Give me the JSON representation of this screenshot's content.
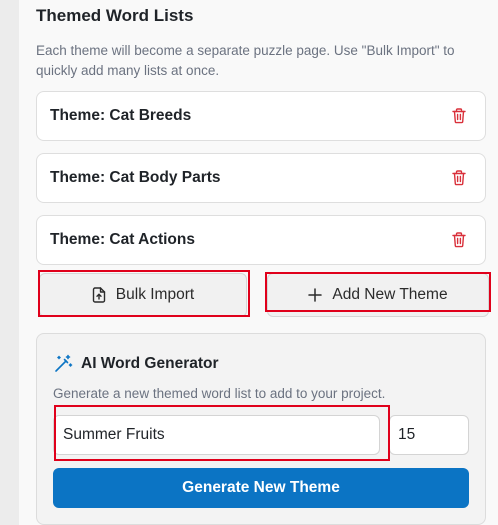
{
  "section": {
    "title": "Themed Word Lists",
    "description": "Each theme will become a separate puzzle page. Use \"Bulk Import\" to quickly add many lists at once."
  },
  "themes": [
    {
      "label": "Theme: Cat Breeds"
    },
    {
      "label": "Theme: Cat Body Parts"
    },
    {
      "label": "Theme: Cat Actions"
    }
  ],
  "actions": {
    "bulk_import_label": "Bulk Import",
    "add_theme_label": "Add New Theme"
  },
  "generator": {
    "title": "AI Word Generator",
    "description": "Generate a new themed word list to add to your project.",
    "topic_value": "Summer Fruits",
    "count_value": "15",
    "button_label": "Generate New Theme"
  },
  "colors": {
    "accent": "#0b74c4",
    "danger": "#d9303a",
    "highlight": "#e0001b"
  },
  "icons": {
    "delete": "trash-icon",
    "bulk_import": "file-upload-icon",
    "add": "plus-icon",
    "generator": "magic-wand-icon"
  }
}
